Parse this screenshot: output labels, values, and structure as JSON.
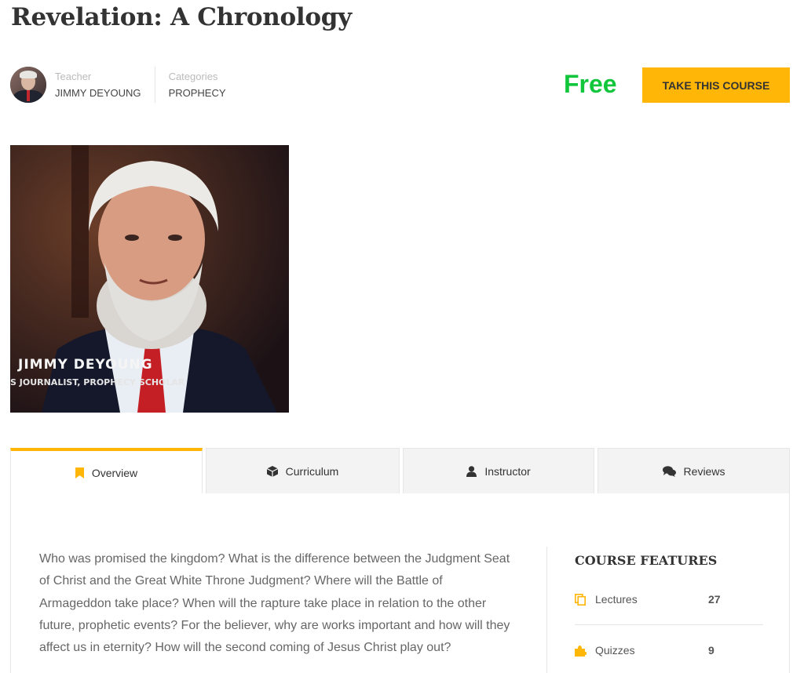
{
  "course": {
    "title": "Revelation: A Chronology",
    "teacher_label": "Teacher",
    "teacher_name": "JIMMY DEYOUNG",
    "category_label": "Categories",
    "category_name": "PROPHECY",
    "price": "Free",
    "cta_label": "TAKE THIS COURSE"
  },
  "image": {
    "name_caption": "JIMMY DEYOUNG",
    "sub_caption": "S JOURNALIST, PROPHECY SCHOLAR"
  },
  "tabs": [
    {
      "label": "Overview",
      "icon": "bookmark-icon",
      "active": true
    },
    {
      "label": "Curriculum",
      "icon": "cube-icon",
      "active": false
    },
    {
      "label": "Instructor",
      "icon": "user-icon",
      "active": false
    },
    {
      "label": "Reviews",
      "icon": "comments-icon",
      "active": false
    }
  ],
  "overview": {
    "text": "Who was promised the kingdom? What is the difference between the Judgment Seat of Christ and the Great White Throne Judgment? Where will the Battle of Armageddon take place? When will the rapture take place in relation to the other future, prophetic events? For the believer, why are works important and how will they affect us in eternity? How will the second coming of Jesus Christ play out?"
  },
  "features": {
    "title": "COURSE FEATURES",
    "items": [
      {
        "label": "Lectures",
        "value": "27",
        "icon": "copy-icon"
      },
      {
        "label": "Quizzes",
        "value": "9",
        "icon": "puzzle-icon"
      }
    ]
  },
  "colors": {
    "accent": "#ffb606",
    "price": "#11c63b"
  }
}
